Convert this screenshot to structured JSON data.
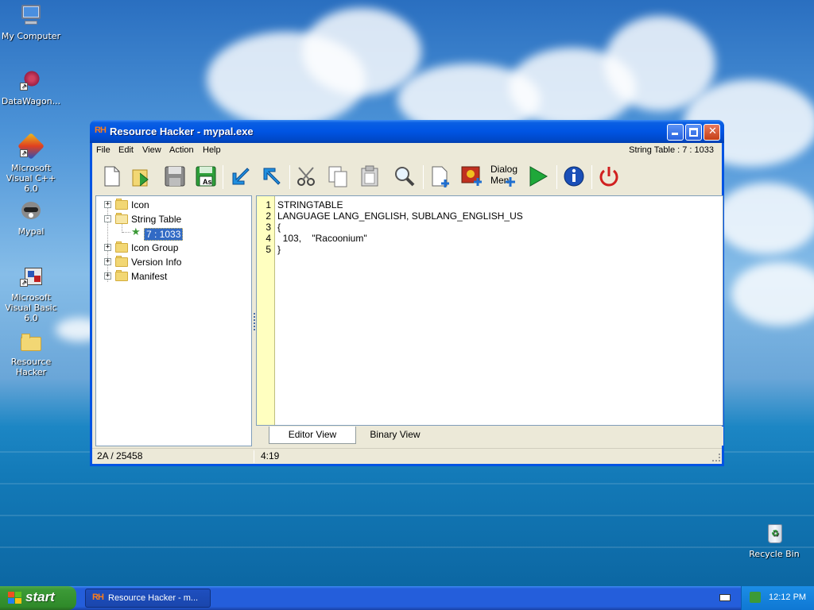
{
  "desktop": {
    "icons": [
      {
        "label": "My Computer"
      },
      {
        "label": "DataWagon..."
      },
      {
        "label": "Microsoft Visual C++ 6.0"
      },
      {
        "label": "Mypal"
      },
      {
        "label": "Microsoft Visual Basic 6.0"
      },
      {
        "label": "Resource Hacker"
      },
      {
        "label": "Recycle Bin"
      }
    ]
  },
  "window": {
    "app_icon": "RH",
    "title": "Resource Hacker - mypal.exe",
    "menu": [
      "File",
      "Edit",
      "View",
      "Action",
      "Help"
    ],
    "menu_status": "String Table : 7 : 1033",
    "toolbar": {
      "dialog_menu_label_line1": "Dialog",
      "dialog_menu_label_line2": "Men",
      "save_as_label": "As"
    },
    "tree": [
      {
        "label": "Icon",
        "expander": "+"
      },
      {
        "label": "String Table",
        "expander": "-"
      },
      {
        "label": "7 : 1033"
      },
      {
        "label": "Icon Group",
        "expander": "+"
      },
      {
        "label": "Version Info",
        "expander": "+"
      },
      {
        "label": "Manifest",
        "expander": "+"
      }
    ],
    "editor": {
      "line_numbers": [
        "1",
        "2",
        "3",
        "4",
        "5"
      ],
      "lines": [
        "STRINGTABLE",
        "LANGUAGE LANG_ENGLISH, SUBLANG_ENGLISH_US",
        "{",
        "  103,    \"Racoonium\"",
        "}"
      ]
    },
    "tabs": [
      "Editor View",
      "Binary View"
    ],
    "status": {
      "left": "2A / 25458",
      "right": "4:19"
    }
  },
  "taskbar": {
    "start_label": "start",
    "task_icon": "RH",
    "task_label": "Resource Hacker - m...",
    "clock": "12:12 PM"
  },
  "colors": {
    "titlebar": "#0054e3",
    "selection": "#316ac5",
    "gutter": "#ffffc0",
    "start_button": "#3c9a37"
  }
}
